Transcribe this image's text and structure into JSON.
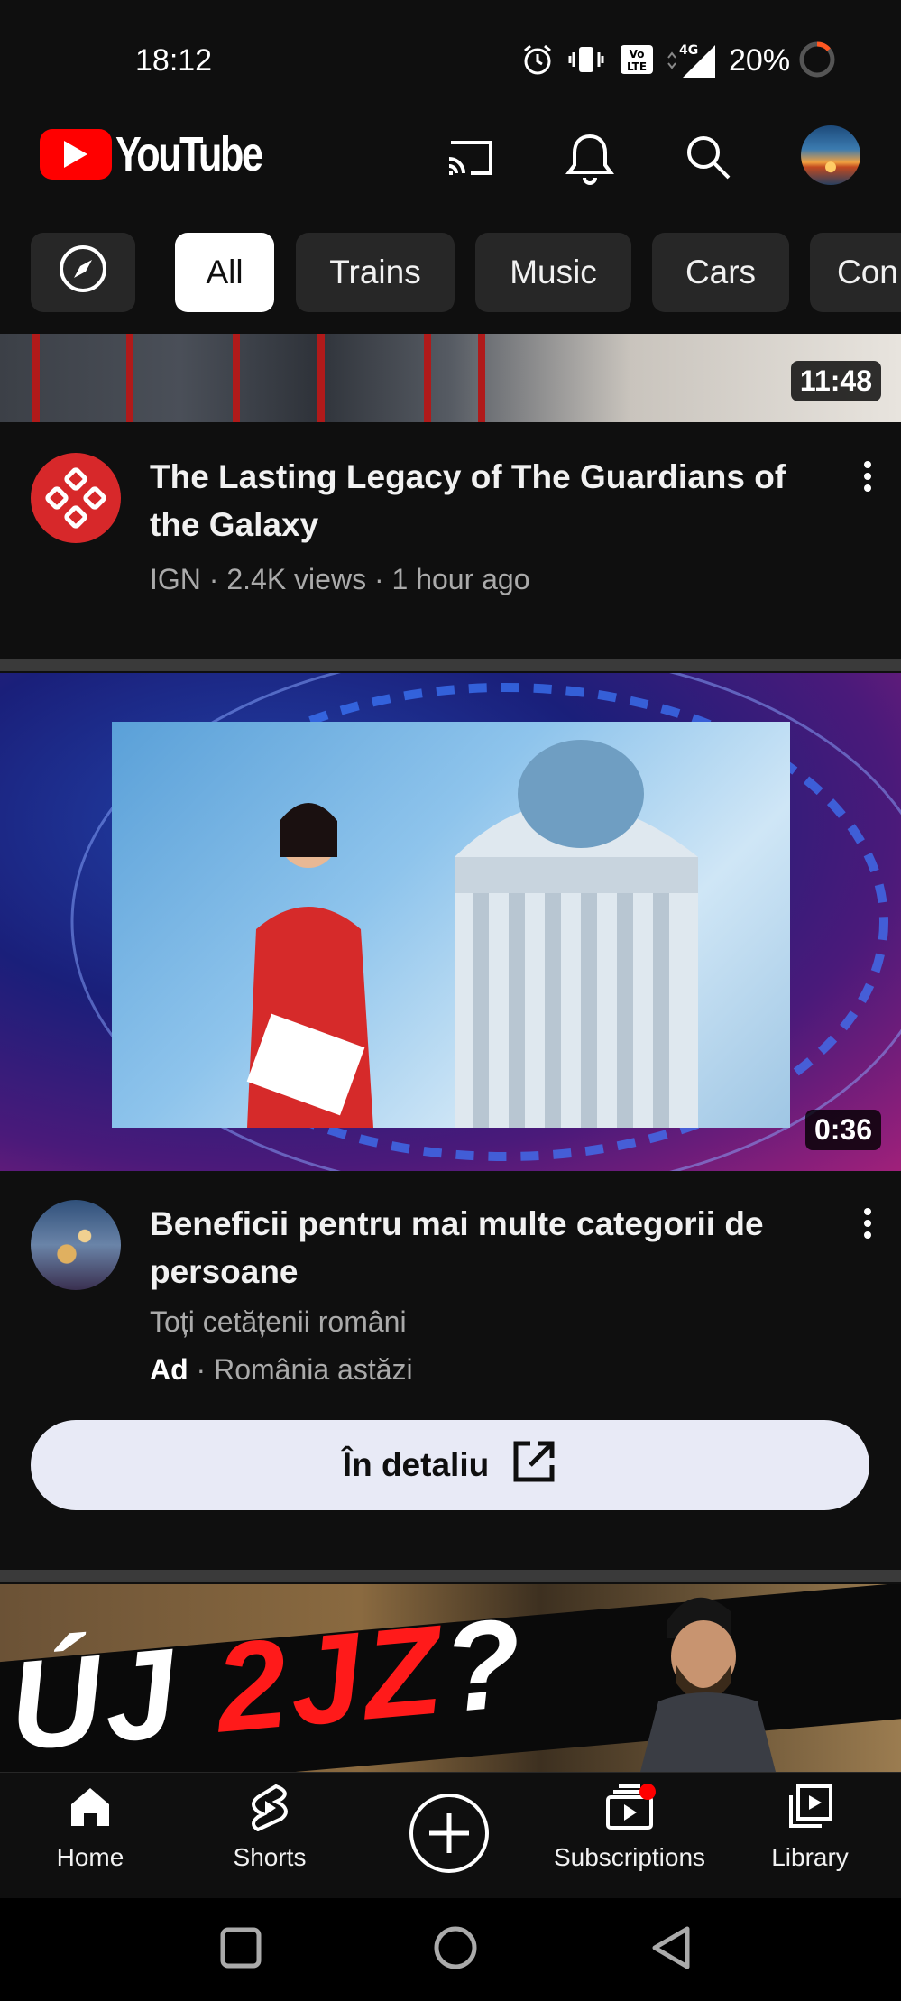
{
  "status_bar": {
    "time": "18:12",
    "battery": "20%",
    "network": "4G",
    "volte": "Vo LTE"
  },
  "app_bar": {
    "logo_text": "YouTube",
    "brand_color": "#ff0000",
    "icons": [
      "cast-icon",
      "notifications-icon",
      "search-icon",
      "account-avatar"
    ]
  },
  "chips": {
    "explore_icon": "compass-icon",
    "items": [
      "All",
      "Trains",
      "Music",
      "Cars",
      "Con"
    ],
    "active": "All"
  },
  "videos": [
    {
      "duration": "11:48",
      "title": "The Lasting Legacy of The Guardians of the Galaxy",
      "meta": "IGN · 2.4K views · 1 hour ago"
    }
  ],
  "ad": {
    "duration": "0:36",
    "title": "Beneficii pentru mai multe categorii de persoane",
    "subtitle": "Toți cetățenii români",
    "badge": "Ad",
    "advertiser": "· România astăzi",
    "cta_label": "În detaliu"
  },
  "next_thumbnail": {
    "text_white": "ÚJ ",
    "text_red": "2JZ",
    "text_end": "?"
  },
  "bottom_nav": {
    "items": [
      "Home",
      "Shorts",
      "Subscriptions",
      "Library"
    ]
  }
}
